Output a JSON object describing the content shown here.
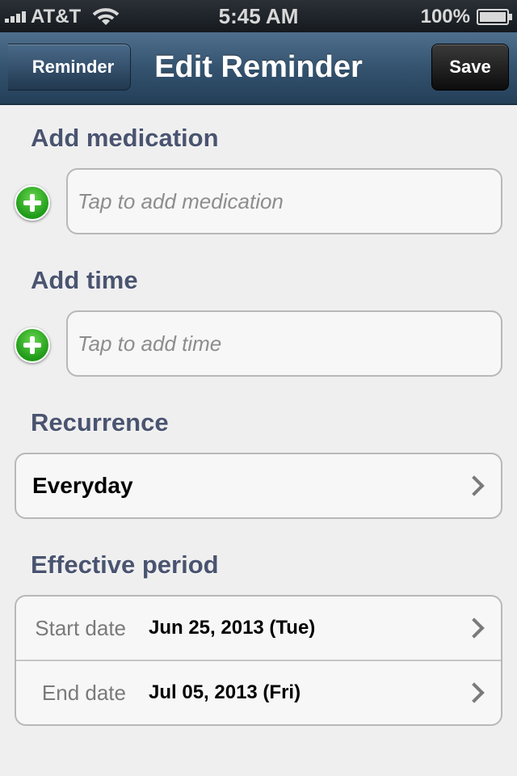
{
  "status_bar": {
    "carrier": "AT&T",
    "time": "5:45 AM",
    "battery": "100%"
  },
  "nav": {
    "back_label": "Reminder",
    "title": "Edit Reminder",
    "save_label": "Save"
  },
  "medication": {
    "title": "Add medication",
    "placeholder": "Tap to add medication"
  },
  "time": {
    "title": "Add time",
    "placeholder": "Tap to add time"
  },
  "recurrence": {
    "title": "Recurrence",
    "value": "Everyday"
  },
  "period": {
    "title": "Effective period",
    "start_label": "Start date",
    "start_value": "Jun 25, 2013 (Tue)",
    "end_label": "End date",
    "end_value": "Jul 05, 2013 (Fri)"
  },
  "colors": {
    "nav_bar": "#34536f",
    "section_title": "#4a5470",
    "add_icon": "#1f9a18",
    "background": "#efefef"
  }
}
